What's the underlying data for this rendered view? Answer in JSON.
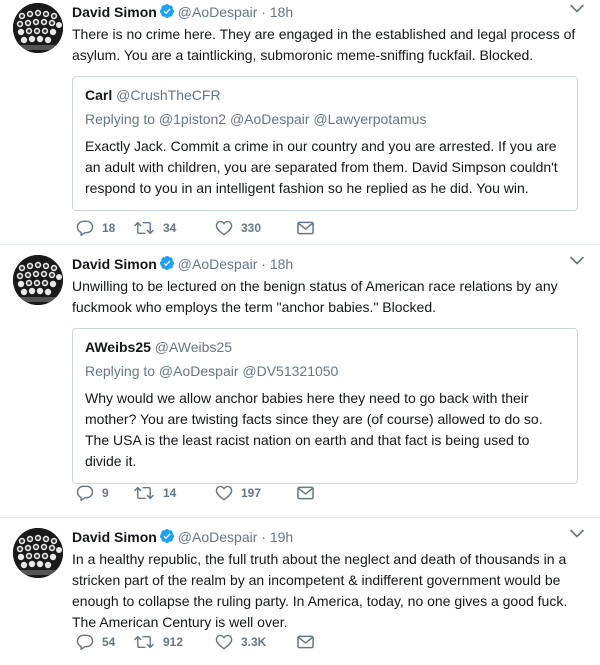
{
  "tweets": [
    {
      "name": "David Simon",
      "handle": "@AoDespair",
      "dot": "·",
      "time": "18h",
      "text": "There is no crime here. They are engaged in the established and legal process of asylum. You are a taintlicking, submoronic meme-sniffing fuckfail. Blocked.",
      "quote": {
        "name": "Carl",
        "handle": "@CrushTheCFR",
        "replying": "Replying to @1piston2 @AoDespair @Lawyerpotamus",
        "text": "Exactly Jack. Commit a crime in our country and you are arrested. If you are an adult with children, you are separated from them. David Simpson couldn't respond to you in an intelligent fashion so he replied as he did. You win."
      },
      "replies": "18",
      "retweets": "34",
      "likes": "330"
    },
    {
      "name": "David Simon",
      "handle": "@AoDespair",
      "dot": "·",
      "time": "18h",
      "text": "Unwilling to be lectured on the benign status of American race relations by any fuckmook who employs the term \"anchor babies.\" Blocked.",
      "quote": {
        "name": "AWeibs25",
        "handle": "@AWeibs25",
        "replying": "Replying to @AoDespair @DV51321050",
        "text": "Why would we allow anchor babies here they need to go back with their mother? You are twisting facts since they are (of course) allowed to do so. The USA is the least racist nation on earth and that fact is being used to divide it."
      },
      "replies": "9",
      "retweets": "14",
      "likes": "197"
    },
    {
      "name": "David Simon",
      "handle": "@AoDespair",
      "dot": "·",
      "time": "19h",
      "text": "In a healthy republic, the full truth about the neglect and death of thousands in a stricken part of the realm by an incompetent & indifferent government would be enough to collapse the ruling party. In America, today, no one gives a good fuck. The American Century is well over.",
      "replies": "54",
      "retweets": "912",
      "likes": "3.3K"
    }
  ],
  "icons": {
    "avatar": "typewriter-avatar",
    "verified": "verified-badge-icon",
    "caret": "chevron-down-icon",
    "reply": "reply-icon",
    "retweet": "retweet-icon",
    "like": "heart-icon",
    "dm": "direct-message-icon"
  },
  "colors": {
    "verified": "#1da1f2",
    "muted": "#657786",
    "text": "#14171a",
    "border": "#e6ecf0",
    "quote_border": "#ccd6dd"
  }
}
